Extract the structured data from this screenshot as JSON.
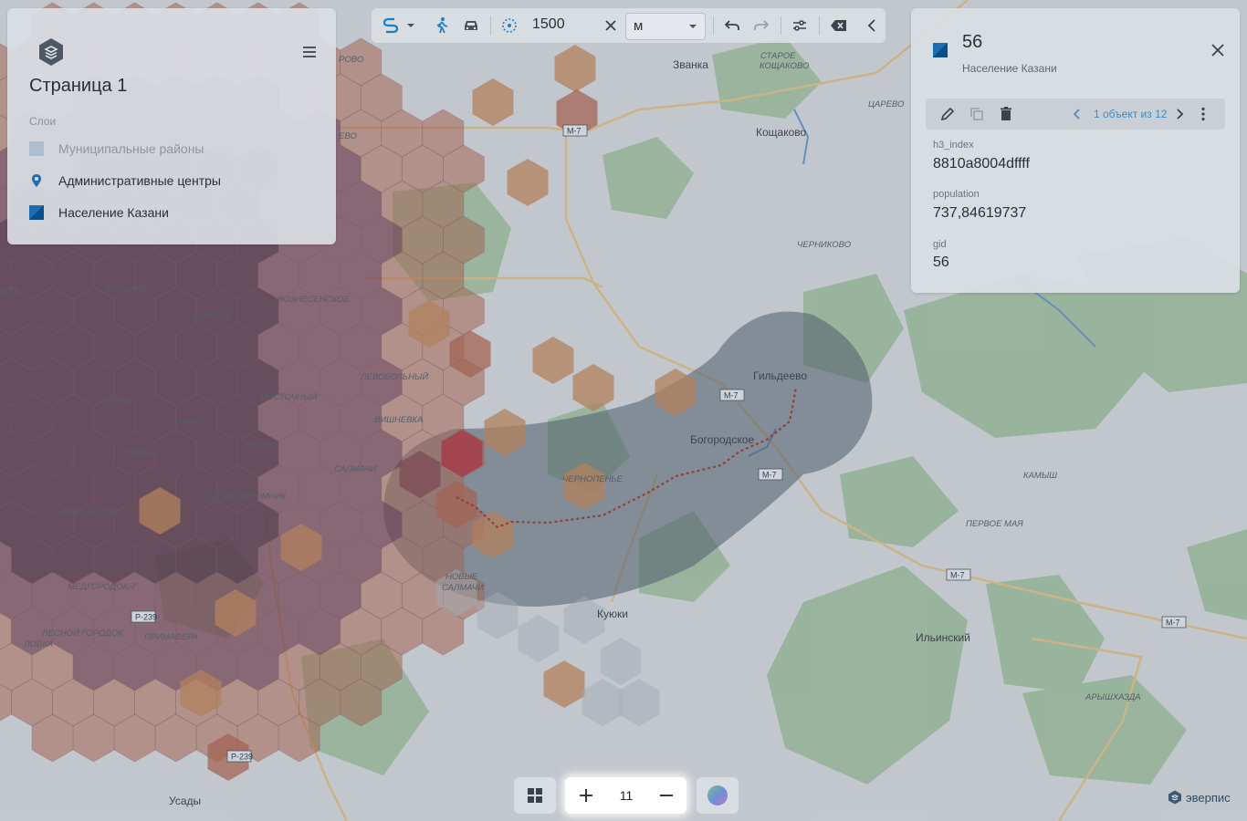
{
  "layers_panel": {
    "title": "Страница 1",
    "section_label": "Слои",
    "menu_icon": "hamburger-icon",
    "logo_icon": "layers-logo-icon",
    "layers": [
      {
        "label": "Муниципальные районы",
        "icon": "polygon-swatch",
        "muted": true
      },
      {
        "label": "Административные центры",
        "icon": "map-pin-icon",
        "muted": false
      },
      {
        "label": "Население Казани",
        "icon": "polygon-swatch",
        "muted": false
      }
    ]
  },
  "toolbar": {
    "radius_value": "1500",
    "unit": "м",
    "icons": [
      "route-icon",
      "chevron-down-icon",
      "walk-icon",
      "car-icon",
      "radius-icon",
      "clear-icon",
      "undo-icon",
      "redo-icon",
      "settings-icon",
      "backspace-icon",
      "chevron-left-icon"
    ]
  },
  "info_panel": {
    "title": "56",
    "subtitle": "Население Казани",
    "pager": "1 объект из 12",
    "attributes": [
      {
        "key": "h3_index",
        "value": "8810a8004dffff"
      },
      {
        "key": "population",
        "value": "737,84619737"
      },
      {
        "key": "gid",
        "value": "56"
      }
    ]
  },
  "zoom": {
    "level": "11"
  },
  "brand": {
    "name": "эверпис"
  },
  "map_labels": {
    "places": [
      "Званка",
      "Кощаково",
      "Гильдеево",
      "Богородское",
      "Куюки",
      "Ильинский",
      "Усады"
    ],
    "localities": [
      "СТАРОЕ",
      "КОЩАКОВО",
      "ЦАРЕВО",
      "ЧЕРНИКОВО",
      "КАМЫШ",
      "ПЕРВОЕ МАЯ",
      "АРЫШХАЗДА",
      "ЧЕРНОПЕНЬЕ",
      "НОВЫЕ",
      "САЛМАЧИ",
      "ДАЛЬНИЙ",
      "АЗИНО-1",
      "ВОЗНЕСЕНСКОЕ",
      "ЛЕВОБОЛЬНЫЙ",
      "ВОСТОЧНЫЙ",
      "ВИШНЕВКА",
      "ГОРКИ-1",
      "ГОРКИ-2",
      "ГОРКИ-3",
      "АЛТАН",
      "САЛМАЧИ",
      "ПЛОДОПИТОМНИК",
      "МЕДГОРОДОК",
      "МЕДГОРОДОК-7",
      "ПРИМАВЕРА",
      "ЛЕСНОЙ ГОРОДОК",
      "ЛОВКА",
      "РОВО",
      "ЕВО",
      "МАЗ"
    ],
    "roads": [
      "М-7",
      "М-7",
      "М-7",
      "М-7",
      "М-7",
      "Р-239",
      "Р-239"
    ]
  }
}
